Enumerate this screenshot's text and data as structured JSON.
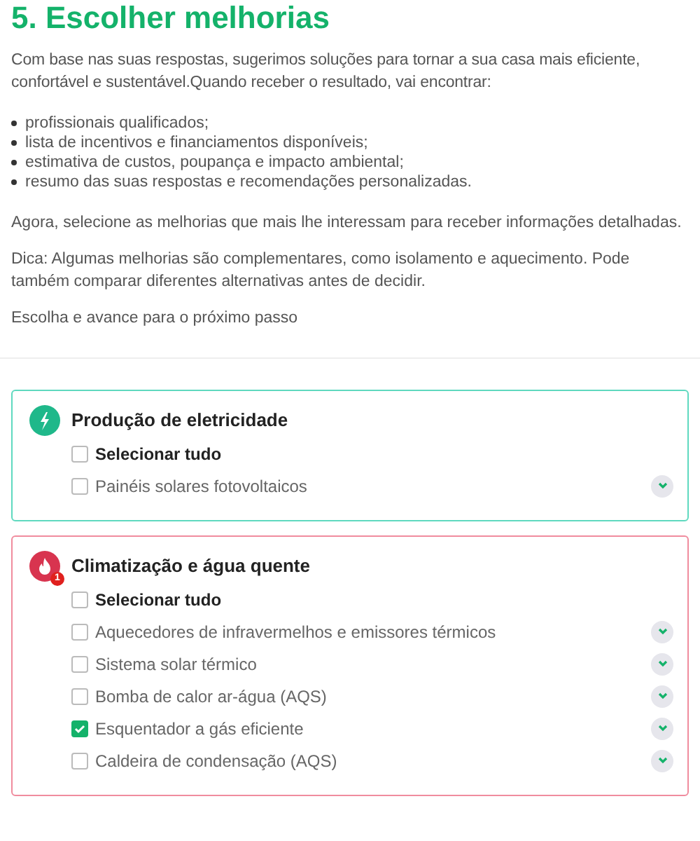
{
  "title": "5. Escolher melhorias",
  "intro": "Com base nas suas respostas, sugerimos soluções para tornar a sua casa mais eficiente, confortável e sustentável.Quando receber o resultado, vai encontrar:",
  "bullets": [
    "profissionais qualificados;",
    "lista de incentivos e financiamentos disponíveis;",
    "estimativa de custos, poupança e impacto ambiental;",
    "resumo das suas respostas e recomendações personalizadas."
  ],
  "paragraphs": [
    "Agora, selecione as melhorias que mais lhe interessam para receber informações detalhadas.",
    "Dica: Algumas melhorias são complementares, como isolamento e aquecimento. Pode também comparar diferentes alternativas antes de decidir.",
    "Escolha e avance para o próximo passo"
  ],
  "sections": [
    {
      "title": "Produção de eletricidade",
      "kind": "electricity",
      "color": "#1fb88a",
      "items": [
        {
          "kind": "select_all",
          "label": "Selecionar tudo",
          "checked": false
        },
        {
          "kind": "option",
          "label": "Painéis solares fotovoltaicos",
          "checked": false
        }
      ]
    },
    {
      "title": "Climatização e água quente",
      "kind": "heating",
      "color": "#d8344f",
      "badge": "1",
      "items": [
        {
          "kind": "select_all",
          "label": "Selecionar tudo",
          "checked": false
        },
        {
          "kind": "option",
          "label": "Aquecedores de infravermelhos e emissores térmicos",
          "checked": false
        },
        {
          "kind": "option",
          "label": "Sistema solar térmico",
          "checked": false
        },
        {
          "kind": "option",
          "label": "Bomba de calor ar-água (AQS)",
          "checked": false
        },
        {
          "kind": "option",
          "label": "Esquentador a gás eficiente",
          "checked": true
        },
        {
          "kind": "option",
          "label": "Caldeira de condensação (AQS)",
          "checked": false
        }
      ]
    }
  ]
}
